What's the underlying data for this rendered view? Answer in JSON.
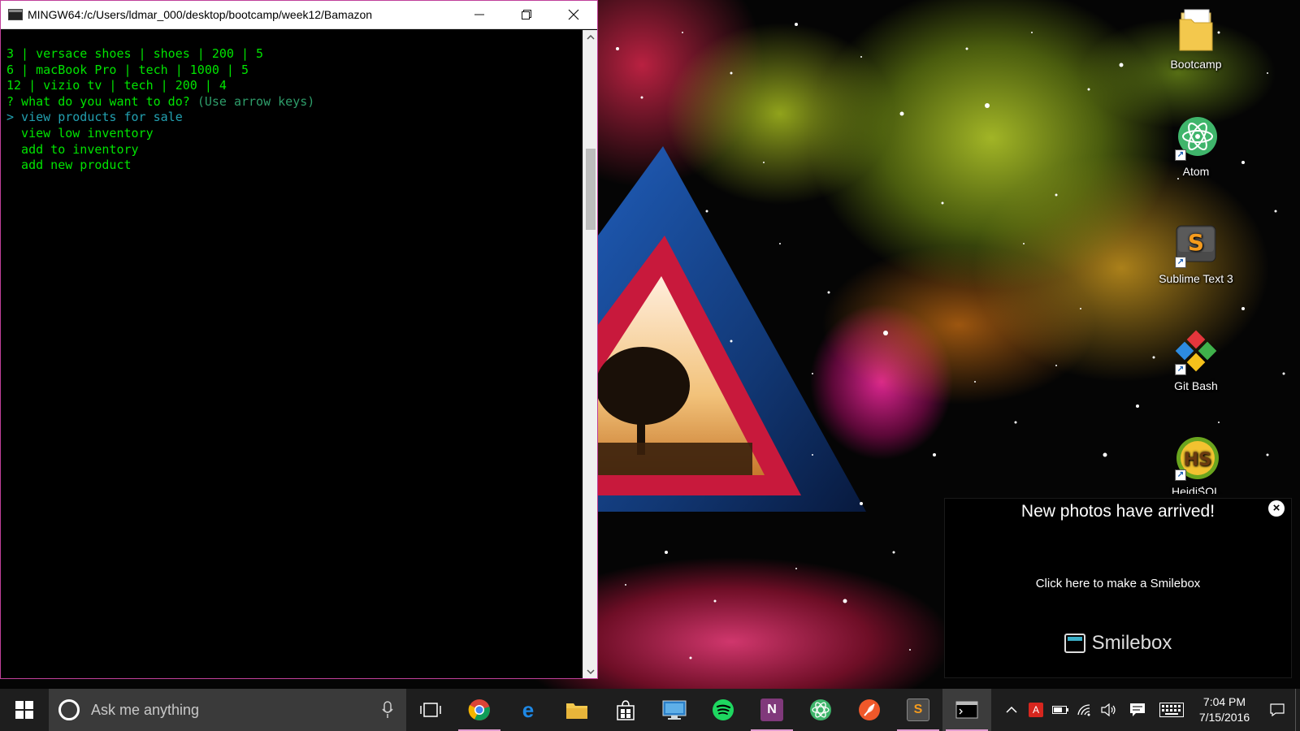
{
  "terminal": {
    "title": "MINGW64:/c/Users/ldmar_000/desktop/bootcamp/week12/Bamazon",
    "lines": [
      "3 | versace shoes | shoes | 200 | 5",
      "6 | macBook Pro | tech | 1000 | 5",
      "12 | vizio tv | tech | 200 | 4"
    ],
    "prompt": "? what do you want to do?",
    "prompt_hint": "(Use arrow keys)",
    "options": [
      "> view products for sale",
      "  view low inventory",
      "  add to inventory",
      "  add new product"
    ]
  },
  "desktop_icons": [
    {
      "label": "Bootcamp",
      "icon": "folder-icon"
    },
    {
      "label": "Atom",
      "icon": "atom-icon"
    },
    {
      "label": "Sublime Text 3",
      "icon": "sublime-icon"
    },
    {
      "label": "Git Bash",
      "icon": "git-icon"
    },
    {
      "label": "HeidiSQL",
      "icon": "heidisql-icon"
    }
  ],
  "toast": {
    "title": "New photos have arrived!",
    "link": "Click here to make a Smilebox",
    "brand": "Smilebox"
  },
  "taskbar": {
    "search_placeholder": "Ask me anything",
    "apps": [
      "chrome-icon",
      "edge-icon",
      "file-explorer-icon",
      "store-icon",
      "remote-desktop-icon",
      "spotify-icon",
      "onenote-icon",
      "atom-icon",
      "feather-icon",
      "sublime-icon",
      "terminal-icon"
    ],
    "time": "7:04 PM",
    "date": "7/15/2016"
  }
}
